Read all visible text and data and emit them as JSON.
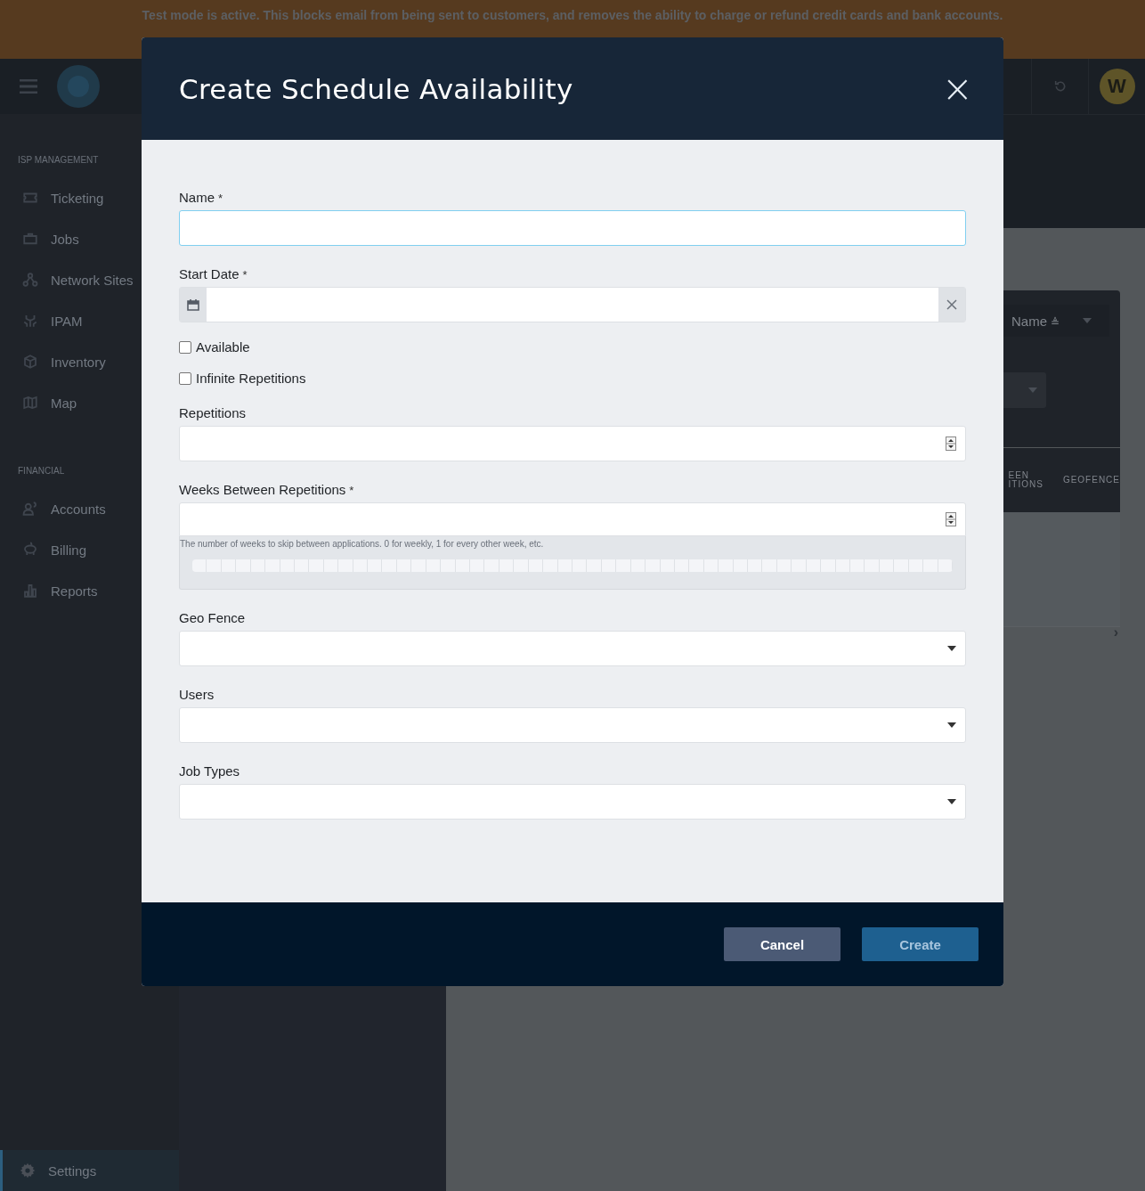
{
  "banner": {
    "text": "Test mode is active. This blocks email from being sent to customers, and removes the ability to charge or refund credit cards and bank accounts."
  },
  "topbar": {
    "avatar": "W"
  },
  "sidebar": {
    "sections": [
      {
        "heading": "ISP MANAGEMENT",
        "items": [
          {
            "label": "Ticketing",
            "selected": false
          },
          {
            "label": "Jobs",
            "selected": false
          },
          {
            "label": "Network Sites",
            "selected": false
          },
          {
            "label": "IPAM",
            "selected": false
          },
          {
            "label": "Inventory",
            "selected": false
          },
          {
            "label": "Map",
            "selected": false
          }
        ]
      },
      {
        "heading": "FINANCIAL",
        "items": [
          {
            "label": "Accounts",
            "selected": false
          },
          {
            "label": "Billing",
            "selected": false
          },
          {
            "label": "Reports",
            "selected": false
          }
        ]
      }
    ],
    "footer_item": {
      "label": "Settings",
      "selected": true
    }
  },
  "background": {
    "sort_select": {
      "value": "Name",
      "sort_mark": "≜"
    },
    "table": {
      "columns": [
        {
          "lines": [
            "EEN",
            "ITIONS"
          ]
        },
        {
          "lines": [
            "GEOFENCE"
          ]
        }
      ]
    },
    "pager": "›"
  },
  "modal": {
    "title": "Create Schedule Availability",
    "close": "×",
    "fields": [
      {
        "kind": "text",
        "label": "Name",
        "required_mark": "*",
        "focused": true
      },
      {
        "kind": "date",
        "label": "Start Date",
        "required_mark": "*",
        "focused": false
      },
      {
        "kind": "checkbox",
        "label": "Available",
        "checked": false
      },
      {
        "kind": "checkbox",
        "label": "Infinite Repetitions",
        "checked": false
      },
      {
        "kind": "number",
        "label": "Repetitions",
        "focused": false
      },
      {
        "kind": "number",
        "label": "Weeks Between Repetitions",
        "required_mark": "*",
        "focused": false,
        "help": "The number of weeks to skip between applications. 0 for weekly, 1 for every other week, etc."
      },
      {
        "kind": "select",
        "label": "Geo Fence",
        "focused": false
      },
      {
        "kind": "select",
        "label": "Users",
        "focused": false
      },
      {
        "kind": "select",
        "label": "Job Types",
        "focused": false
      }
    ],
    "buttons": [
      {
        "label": "Cancel",
        "kind": "secondary"
      },
      {
        "label": "Create",
        "kind": "primary"
      }
    ]
  }
}
